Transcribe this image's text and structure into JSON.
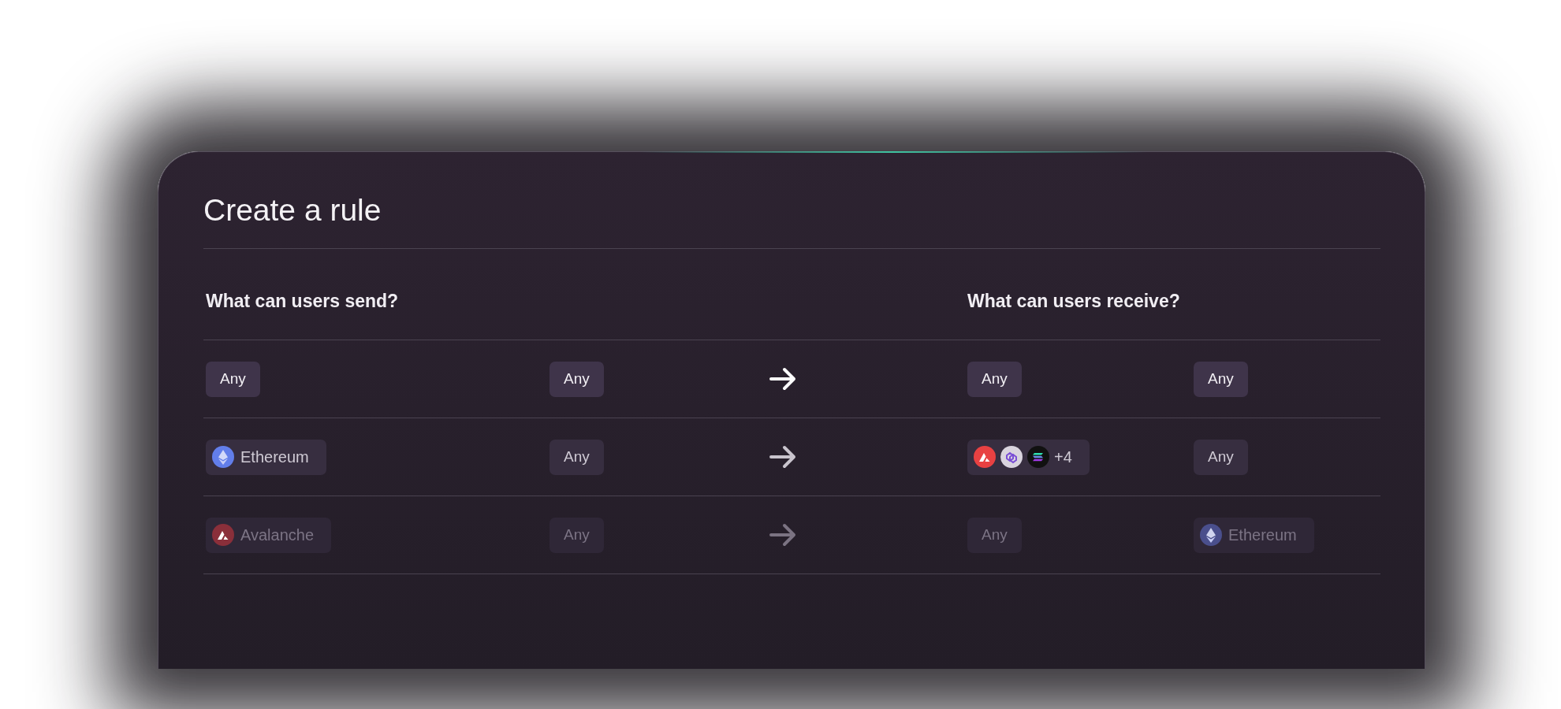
{
  "dialog": {
    "title": "Create a rule"
  },
  "headers": {
    "send": "What can users send?",
    "receive": "What can users receive?"
  },
  "rules": [
    {
      "highlighted": true,
      "disabled": false,
      "cells": [
        {
          "kind": "any",
          "label": "Any"
        },
        {
          "kind": "any",
          "label": "Any"
        },
        {
          "kind": "any",
          "label": "Any"
        },
        {
          "kind": "any",
          "label": "Any"
        }
      ]
    },
    {
      "highlighted": false,
      "disabled": false,
      "cells": [
        {
          "kind": "token",
          "label": "Ethereum",
          "icons": [
            {
              "kind": "diamond",
              "color": "#627eea"
            }
          ]
        },
        {
          "kind": "any",
          "label": "Any"
        },
        {
          "kind": "stack",
          "label": "+4",
          "icons": [
            {
              "kind": "peak",
              "color": "#e84142"
            },
            {
              "kind": "links",
              "color": "#d9d4de"
            },
            {
              "kind": "stripes",
              "color": "#111111"
            }
          ]
        },
        {
          "kind": "any",
          "label": "Any"
        }
      ]
    },
    {
      "highlighted": false,
      "disabled": true,
      "cells": [
        {
          "kind": "token",
          "label": "Avalanche",
          "icons": [
            {
              "kind": "peak",
              "color": "#8a2f3a"
            }
          ]
        },
        {
          "kind": "any",
          "label": "Any"
        },
        {
          "kind": "any",
          "label": "Any"
        },
        {
          "kind": "token",
          "label": "Ethereum",
          "icons": [
            {
              "kind": "diamond",
              "color": "#4a4f8c"
            }
          ]
        }
      ]
    }
  ]
}
